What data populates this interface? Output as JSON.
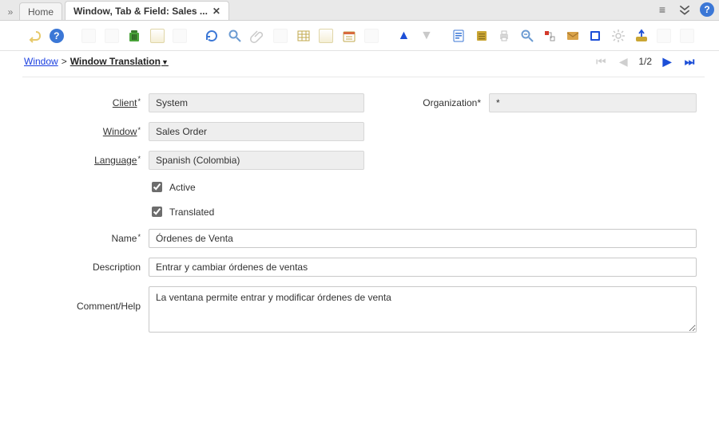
{
  "window": {
    "tabs": [
      {
        "label": "Home",
        "active": false,
        "closable": false
      },
      {
        "label": "Window, Tab & Field: Sales ...",
        "active": true,
        "closable": true
      }
    ],
    "rightIcons": {
      "menu": "≡",
      "chevrons": "⌄",
      "help": "?"
    }
  },
  "breadcrumb": {
    "parent": "Window",
    "separator": ">",
    "current": "Window Translation"
  },
  "pager": {
    "text": "1/2"
  },
  "form": {
    "client": {
      "label": "Client",
      "value": "System"
    },
    "organization": {
      "label": "Organization",
      "value": "*"
    },
    "window": {
      "label": "Window",
      "value": "Sales Order"
    },
    "language": {
      "label": "Language",
      "value": "Spanish (Colombia)"
    },
    "active": {
      "label": "Active",
      "checked": true
    },
    "translated": {
      "label": "Translated",
      "checked": true
    },
    "name": {
      "label": "Name",
      "value": "Órdenes de Venta"
    },
    "description": {
      "label": "Description",
      "value": "Entrar y cambiar órdenes de ventas"
    },
    "help": {
      "label": "Comment/Help",
      "value": "La ventana permite entrar y modificar órdenes de venta"
    }
  }
}
